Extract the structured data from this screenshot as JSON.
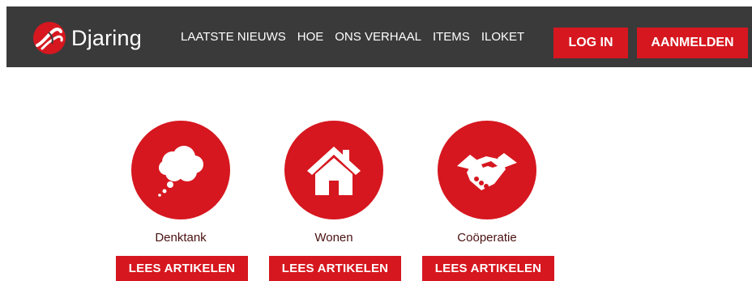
{
  "brand": {
    "name": "Djaring",
    "logo_icon": "knot-logo-icon",
    "accent": "#d6171f",
    "bar_color": "#3a3a3a"
  },
  "nav": {
    "items": [
      {
        "label": "LAATSTE NIEUWS"
      },
      {
        "label": "HOE"
      },
      {
        "label": "ONS VERHAAL"
      },
      {
        "label": "ITEMS"
      },
      {
        "label": "ILOKET"
      }
    ]
  },
  "auth": {
    "login_label": "LOG IN",
    "signup_label": "AANMELDEN"
  },
  "categories": [
    {
      "icon": "thought-cloud-icon",
      "label": "Denktank",
      "button_label": "LEES ARTIKELEN"
    },
    {
      "icon": "house-icon",
      "label": "Wonen",
      "button_label": "LEES ARTIKELEN"
    },
    {
      "icon": "handshake-icon",
      "label": "Coöperatie",
      "button_label": "LEES ARTIKELEN"
    }
  ]
}
